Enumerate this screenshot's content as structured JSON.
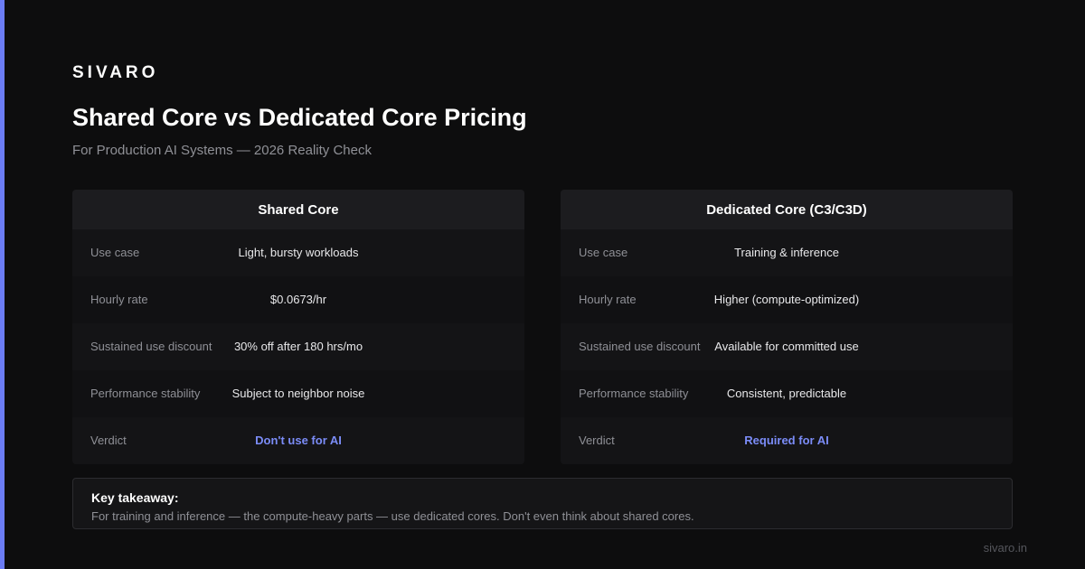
{
  "brand": "SIVARO",
  "title": "Shared Core vs Dedicated Core Pricing",
  "subtitle": "For Production AI Systems — 2026 Reality Check",
  "colors": {
    "accent": "#6b7cf5",
    "verdict": "#7b8cf7",
    "background": "#0d0d0e"
  },
  "columns": [
    {
      "header": "Shared Core",
      "rows": [
        {
          "label": "Use case",
          "value": "Light, bursty workloads"
        },
        {
          "label": "Hourly rate",
          "value": "$0.0673/hr"
        },
        {
          "label": "Sustained use discount",
          "value": "30% off after 180 hrs/mo"
        },
        {
          "label": "Performance stability",
          "value": "Subject to neighbor noise"
        },
        {
          "label": "Verdict",
          "value": "Don't use for AI"
        }
      ]
    },
    {
      "header": "Dedicated Core (C3/C3D)",
      "rows": [
        {
          "label": "Use case",
          "value": "Training & inference"
        },
        {
          "label": "Hourly rate",
          "value": "Higher (compute-optimized)"
        },
        {
          "label": "Sustained use discount",
          "value": "Available for committed use"
        },
        {
          "label": "Performance stability",
          "value": "Consistent, predictable"
        },
        {
          "label": "Verdict",
          "value": "Required for AI"
        }
      ]
    }
  ],
  "takeaway": {
    "title": "Key takeaway:",
    "text": "For training and inference — the compute-heavy parts — use dedicated cores. Don't even think about shared cores."
  },
  "footer": "sivaro.in"
}
